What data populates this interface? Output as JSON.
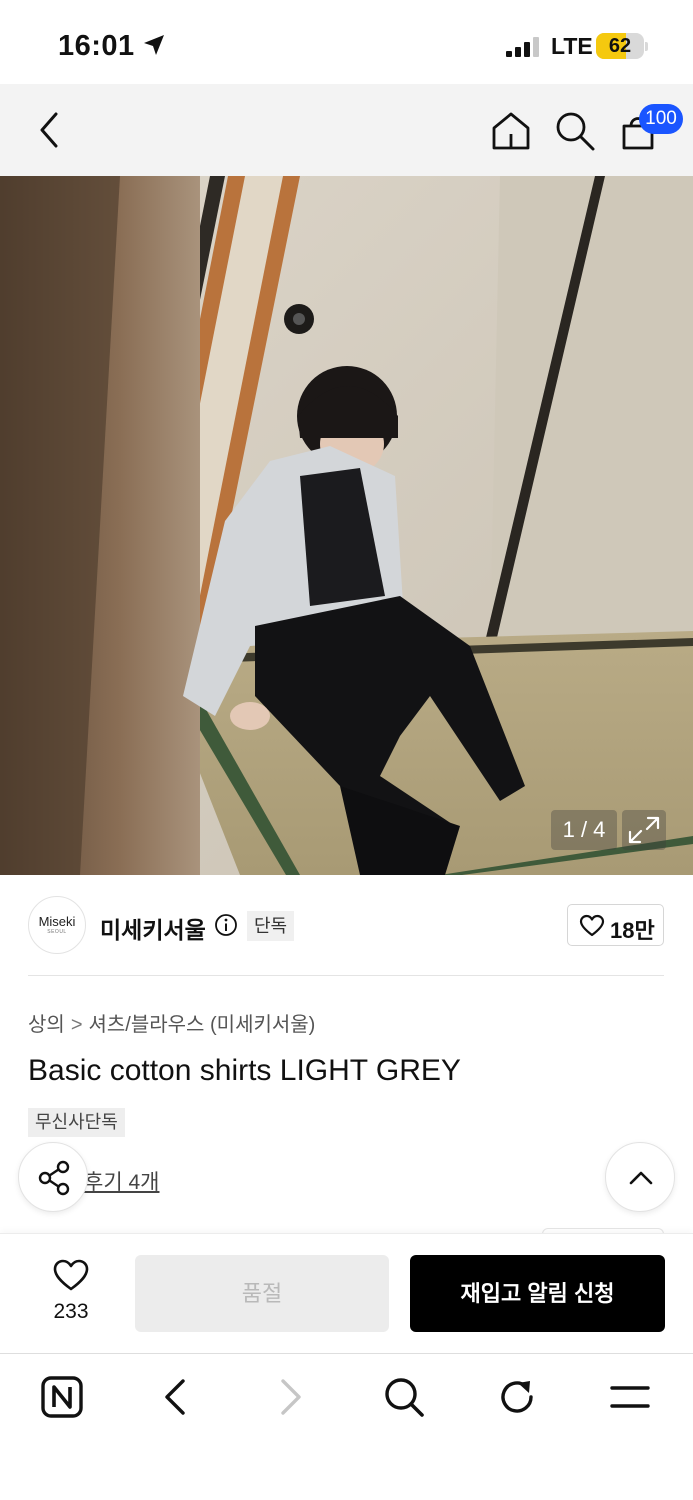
{
  "status_bar": {
    "time": "16:01",
    "network": "LTE",
    "battery": "62",
    "battery_level": 0.62
  },
  "header": {
    "cart_badge": "100",
    "icons": [
      "back-icon",
      "home-icon",
      "search-icon",
      "cart-icon"
    ]
  },
  "gallery": {
    "counter": "1 / 4",
    "expand_icon": "expand-icon"
  },
  "brand": {
    "logo_text": "Miseki",
    "logo_subtext": "SEOUL",
    "name": "미세키서울",
    "tag": "단독",
    "likes": "18만"
  },
  "product": {
    "breadcrumb": [
      "상의",
      "셔츠/블라우스 (미세키서울)"
    ],
    "title": "Basic cotton shirts LIGHT GREY",
    "badge": "무신사단독",
    "review_link": "후기 4개"
  },
  "purchase": {
    "wish_count": "233",
    "soldout_label": "품절",
    "restock_label": "재입고 알림 신청"
  },
  "browser_toolbar": {
    "icons": [
      "naver-icon",
      "browser-back-icon",
      "browser-forward-icon",
      "browser-search-icon",
      "refresh-icon",
      "menu-icon"
    ]
  },
  "colors": {
    "accent_blue": "#1a55ff",
    "battery_yellow": "#f5c90f",
    "cta_black": "#000000",
    "soldout_grey": "#ececec"
  }
}
